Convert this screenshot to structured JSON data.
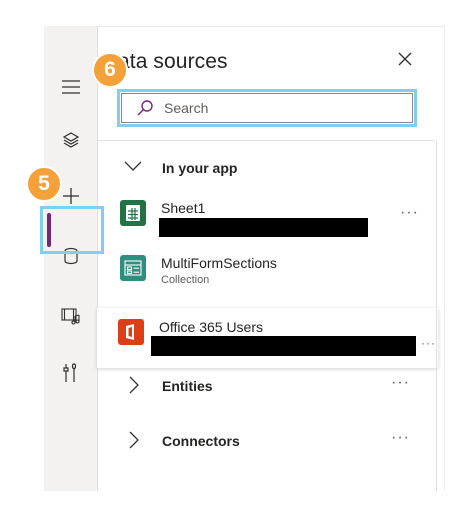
{
  "panel": {
    "title": "ata sources",
    "close_label": "×",
    "search": {
      "placeholder": "Search",
      "value": ""
    }
  },
  "callouts": {
    "left_badge": "5",
    "top_badge": "6",
    "color": "#f4a13a",
    "outline_color": "#81cff0"
  },
  "rail": {
    "items": [
      {
        "name": "hamburger-menu",
        "icon": "menu-icon"
      },
      {
        "name": "layers",
        "icon": "layers-icon"
      },
      {
        "name": "insert",
        "icon": "plus-icon"
      },
      {
        "name": "data",
        "icon": "database-icon",
        "active": true
      },
      {
        "name": "media",
        "icon": "media-icon"
      },
      {
        "name": "advanced-tools",
        "icon": "tools-icon"
      }
    ],
    "active_color": "#742774"
  },
  "sections": {
    "in_your_app": {
      "label": "In your app",
      "expanded": true
    },
    "entities": {
      "label": "Entities",
      "expanded": false,
      "more": "···"
    },
    "connectors": {
      "label": "Connectors",
      "expanded": false,
      "more": "···"
    }
  },
  "sources": [
    {
      "name": "Sheet1",
      "subtitle": "",
      "icon": "excel-sheet-icon",
      "color": "#217346",
      "more": "···"
    },
    {
      "name": "MultiFormSections",
      "subtitle": "Collection",
      "icon": "collection-icon",
      "color": "#2f8f7f"
    },
    {
      "name": "Office 365 Users",
      "subtitle": "",
      "icon": "office-icon",
      "color": "#dc3e15",
      "more": "···"
    }
  ]
}
